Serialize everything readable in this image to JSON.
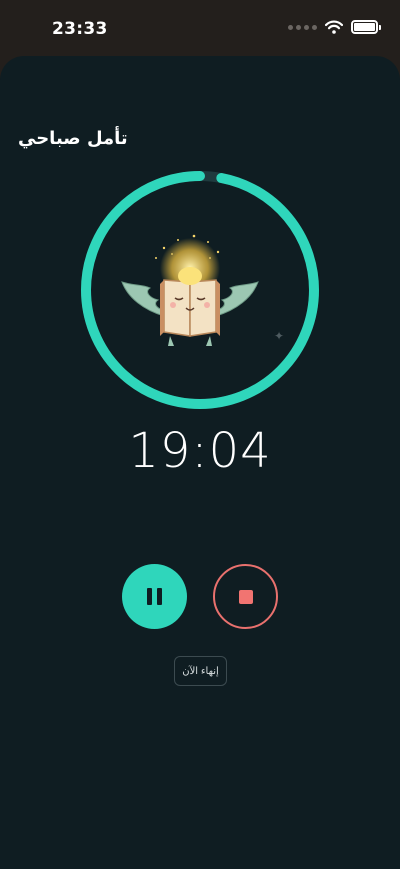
{
  "status_bar": {
    "time": "23:33",
    "icons": [
      "signal-dots-icon",
      "wifi-icon",
      "battery-icon"
    ]
  },
  "session": {
    "title": "تأمل صباحي",
    "remaining_time": "19:04",
    "progress": 0.97
  },
  "controls": {
    "pause_icon": "pause-icon",
    "stop_icon": "stop-icon",
    "end_now_label": "إنهاء الآن"
  },
  "colors": {
    "accent": "#2fd6bb",
    "danger": "#f17471",
    "background": "#0f1d22",
    "ring_track": "#1f3a3e"
  }
}
